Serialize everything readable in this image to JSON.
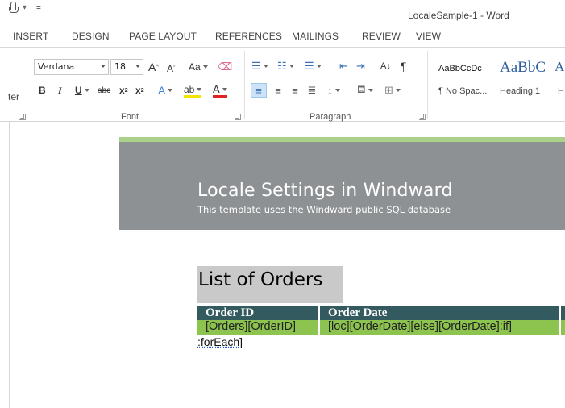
{
  "window": {
    "title": "LocaleSample-1 - Word"
  },
  "tabs": [
    "INSERT",
    "DESIGN",
    "PAGE LAYOUT",
    "REFERENCES",
    "MAILINGS",
    "REVIEW",
    "VIEW"
  ],
  "ribbon": {
    "clipboard_partial_label": "ter",
    "font": {
      "family": "Verdana",
      "size": "18",
      "grow": "A",
      "shrink": "A",
      "change_case": "Aa",
      "bold": "B",
      "italic": "I",
      "underline": "U",
      "strike": "abc",
      "subscript": "x",
      "superscript": "x",
      "text_effects": "A",
      "highlight": "ab",
      "font_color": "A",
      "group_label": "Font"
    },
    "paragraph": {
      "sort": "A↓",
      "pilcrow": "¶",
      "group_label": "Paragraph"
    },
    "styles": [
      {
        "sample": "AaBbCcDc",
        "name": "¶ No Spac..."
      },
      {
        "sample": "AaBbC",
        "name": "Heading 1"
      },
      {
        "sample": "A",
        "name": "H"
      }
    ]
  },
  "document": {
    "banner_title": "Locale Settings in Windward",
    "banner_subtitle": "This template uses the Windward public SQL database",
    "list_title": "List of Orders",
    "table": {
      "headers": [
        "Order ID",
        "Order Date"
      ],
      "row": [
        "[Orders][OrderID]",
        "[loc][OrderDate][else][OrderDate]:if]"
      ]
    },
    "foreach_tag": ":forEach",
    "foreach_close": "]"
  },
  "colors": {
    "banner": "#8e9193",
    "accent_line": "#aad18a",
    "table_header": "#335a5f",
    "table_row": "#8dc44f",
    "list_title_bg": "#c9c9c9"
  }
}
